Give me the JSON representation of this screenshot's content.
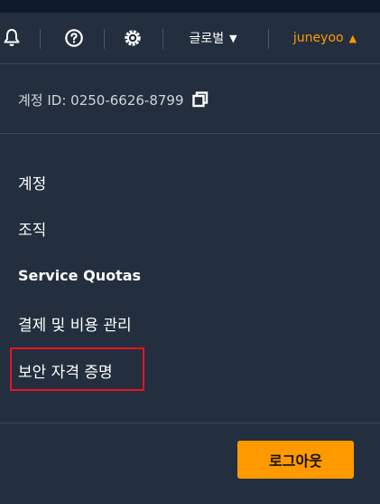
{
  "nav": {
    "bell_icon": "bell-icon",
    "help_icon": "help-circle-icon",
    "settings_icon": "gear-icon",
    "region_label": "글로벌",
    "region_caret": "▼",
    "user_label": "juneyoo",
    "user_caret": "▲",
    "user_color": "#ff9900"
  },
  "account": {
    "id_label": "계정 ID: 0250-6626-8799",
    "copy_icon": "copy-icon"
  },
  "menu": {
    "items": [
      {
        "label": "계정"
      },
      {
        "label": "조직"
      },
      {
        "label": "Service Quotas"
      },
      {
        "label": "결제 및 비용 관리"
      },
      {
        "label": "보안 자격 증명",
        "highlighted": true,
        "highlight_color": "#e8131d"
      }
    ]
  },
  "footer": {
    "logout_label": "로그아웃",
    "logout_color": "#ff9900"
  }
}
